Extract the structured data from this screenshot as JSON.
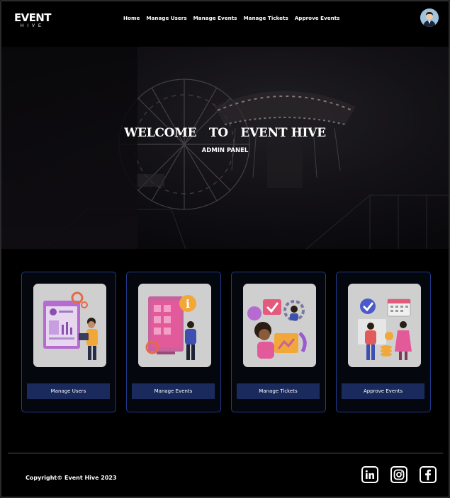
{
  "brand": {
    "name": "EVENT",
    "tagline": "HIVE"
  },
  "nav": {
    "items": [
      {
        "label": "Home"
      },
      {
        "label": "Manage Users"
      },
      {
        "label": "Manage Events"
      },
      {
        "label": "Manage Tickets"
      },
      {
        "label": "Approve Events"
      }
    ],
    "avatar_icon": "user-avatar-icon"
  },
  "hero": {
    "title_words": [
      "WELCOME",
      "TO",
      "EVENT HIVE"
    ],
    "subtitle": "ADMIN PANEL"
  },
  "cards": [
    {
      "label": "Manage Users",
      "illustration": "manage-users-illustration"
    },
    {
      "label": "Manage Events",
      "illustration": "manage-events-illustration"
    },
    {
      "label": "Manage Tickets",
      "illustration": "manage-tickets-illustration"
    },
    {
      "label": "Approve Events",
      "illustration": "approve-events-illustration"
    }
  ],
  "footer": {
    "copyright": "Copyright© Event Hive 2023",
    "social": [
      {
        "icon": "linkedin-icon"
      },
      {
        "icon": "instagram-icon"
      },
      {
        "icon": "facebook-icon"
      }
    ]
  },
  "colors": {
    "background": "#000000",
    "card_border": "#1f3a8a",
    "button_bg": "#1b2a5c"
  }
}
